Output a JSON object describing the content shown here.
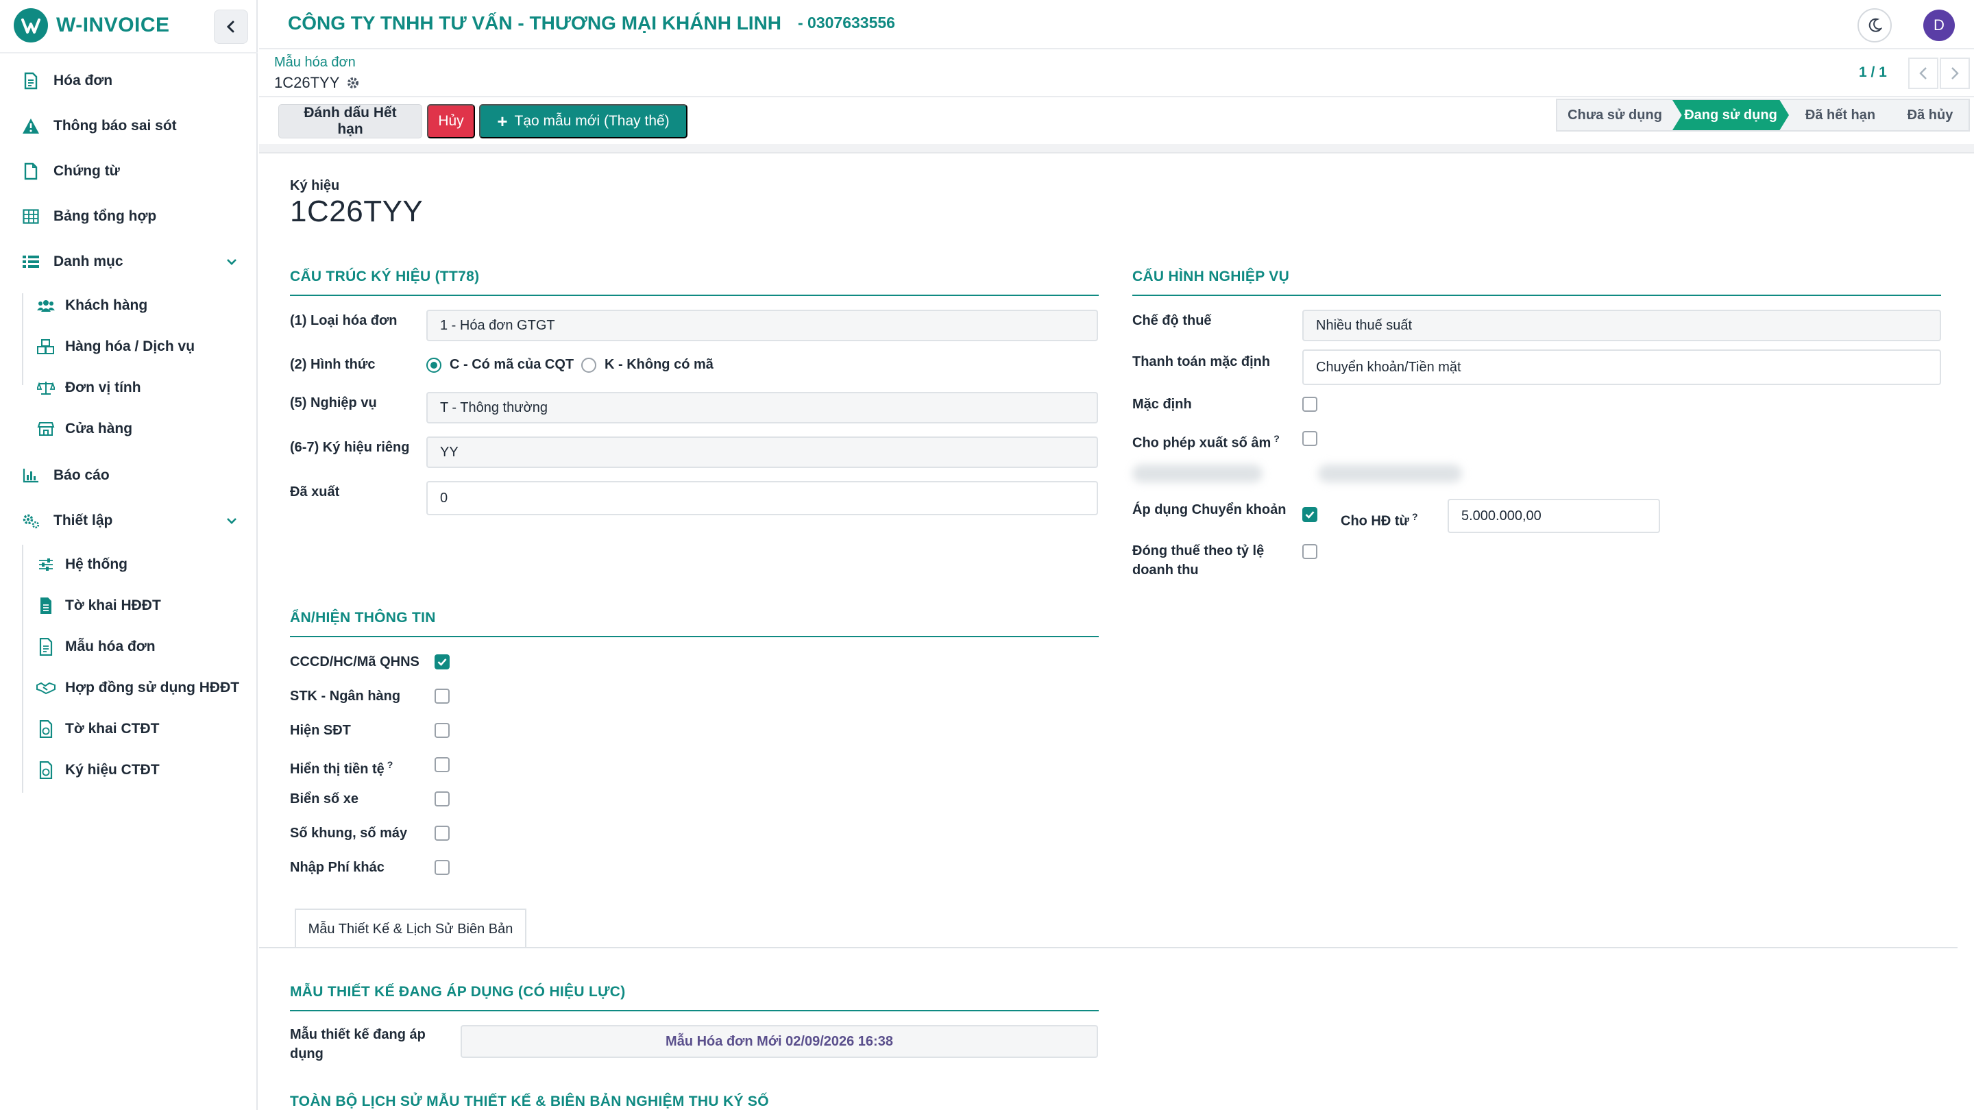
{
  "brand": {
    "name": "W-INVOICE"
  },
  "sidebar": {
    "items": [
      {
        "label": "Hóa đơn",
        "icon": "invoice-icon"
      },
      {
        "label": "Thông báo sai sót",
        "icon": "warning-icon"
      },
      {
        "label": "Chứng từ",
        "icon": "document-icon"
      },
      {
        "label": "Bảng tổng hợp",
        "icon": "table-icon"
      },
      {
        "label": "Danh mục",
        "icon": "list-icon",
        "expandable": true
      },
      {
        "label": "Khách hàng",
        "icon": "users-icon",
        "sub": true
      },
      {
        "label": "Hàng hóa / Dịch vụ",
        "icon": "boxes-icon",
        "sub": true
      },
      {
        "label": "Đơn vị tính",
        "icon": "scale-icon",
        "sub": true
      },
      {
        "label": "Cửa hàng",
        "icon": "store-icon",
        "sub": true
      },
      {
        "label": "Báo cáo",
        "icon": "chart-icon"
      },
      {
        "label": "Thiết lập",
        "icon": "cogs-icon",
        "expandable": true
      },
      {
        "label": "Hệ thống",
        "icon": "sliders-icon",
        "sub": true
      },
      {
        "label": "Tờ khai HĐĐT",
        "icon": "file-icon",
        "sub": true
      },
      {
        "label": "Mẫu hóa đơn",
        "icon": "file-text-icon",
        "sub": true
      },
      {
        "label": "Hợp đồng sử dụng HĐĐT",
        "icon": "handshake-icon",
        "sub": true
      },
      {
        "label": "Tờ khai CTĐT",
        "icon": "file-chart-icon",
        "sub": true
      },
      {
        "label": "Ký hiệu CTĐT",
        "icon": "file-chart-icon",
        "sub": true
      }
    ]
  },
  "header": {
    "company": "CÔNG TY TNHH TƯ VẤN - THƯƠNG MẠI KHÁNH LINH",
    "taxcode": "- 0307633556",
    "avatar_initial": "D"
  },
  "breadcrumb": {
    "parent": "Mẫu hóa đơn",
    "current": "1C26TYY"
  },
  "pager": {
    "text": "1 / 1"
  },
  "actions": {
    "mark_expired": "Đánh dấu Hết hạn",
    "cancel": "Hủy",
    "create_new": "Tạo mẫu mới (Thay thế)"
  },
  "status_steps": [
    "Chưa sử dụng",
    "Đang sử dụng",
    "Đã hết hạn",
    "Đã hủy"
  ],
  "status_active": "Đang sử dụng",
  "form": {
    "symbol_label": "Ký hiệu",
    "symbol_value": "1C26TYY",
    "structure": {
      "title": "CẤU TRÚC KÝ HIỆU (TT78)",
      "invoice_type_label": "(1) Loại hóa đơn",
      "invoice_type_value": "1 - Hóa đơn GTGT",
      "form_label": "(2) Hình thức",
      "form_option_c": "C - Có mã của CQT",
      "form_option_k": "K - Không có mã",
      "form_selected": "C",
      "business_label": "(5) Nghiệp vụ",
      "business_value": "T - Thông thường",
      "private_label": "(6-7) Ký hiệu riêng",
      "private_value": "YY",
      "issued_label": "Đã xuất",
      "issued_value": "0"
    },
    "config": {
      "title": "CẤU HÌNH NGHIỆP VỤ",
      "tax_mode_label": "Chế độ thuế",
      "tax_mode_value": "Nhiều thuế suất",
      "payment_label": "Thanh toán mặc định",
      "payment_value": "Chuyển khoản/Tiền mặt",
      "default_label": "Mặc định",
      "default_checked": false,
      "negative_label": "Cho phép xuất số âm",
      "negative_checked": false,
      "transfer_label": "Áp dụng Chuyển khoản",
      "transfer_checked": true,
      "from_amount_label": "Cho HĐ từ",
      "from_amount_value": "5.000.000,00",
      "revenue_tax_label_1": "Đóng thuế theo tỷ lệ",
      "revenue_tax_label_2": "doanh thu",
      "revenue_tax_checked": false
    },
    "visibility": {
      "title": "ẨN/HIỆN THÔNG TIN",
      "items": [
        {
          "label": "CCCD/HC/Mã QHNS",
          "checked": true
        },
        {
          "label": "STK - Ngân hàng",
          "checked": false
        },
        {
          "label": "Hiện SĐT",
          "checked": false
        },
        {
          "label": "Hiển thị tiền tệ",
          "checked": false,
          "help": "?"
        },
        {
          "label": "Biển số xe",
          "checked": false
        },
        {
          "label": "Số khung, số máy",
          "checked": false
        },
        {
          "label": "Nhập Phí khác",
          "checked": false
        }
      ]
    },
    "tab_label": "Mẫu Thiết Kế & Lịch Sử Biên Bản",
    "design": {
      "title": "MẪU THIẾT KẾ ĐANG ÁP DỤNG (CÓ HIỆU LỰC)",
      "applied_label_1": "Mẫu thiết kế đang áp",
      "applied_label_2": "dụng",
      "applied_value": "Mẫu Hóa đơn Mới 02/09/2026 16:38",
      "history_title": "TOÀN BỘ LỊCH SỬ MẪU THIẾT KẾ & BIÊN BẢN NGHIỆM THU KÝ SỐ"
    }
  },
  "colors": {
    "primary": "#0f8a82",
    "danger": "#e0344a",
    "active_step": "#10a27a",
    "avatar": "#5a3ea6"
  }
}
